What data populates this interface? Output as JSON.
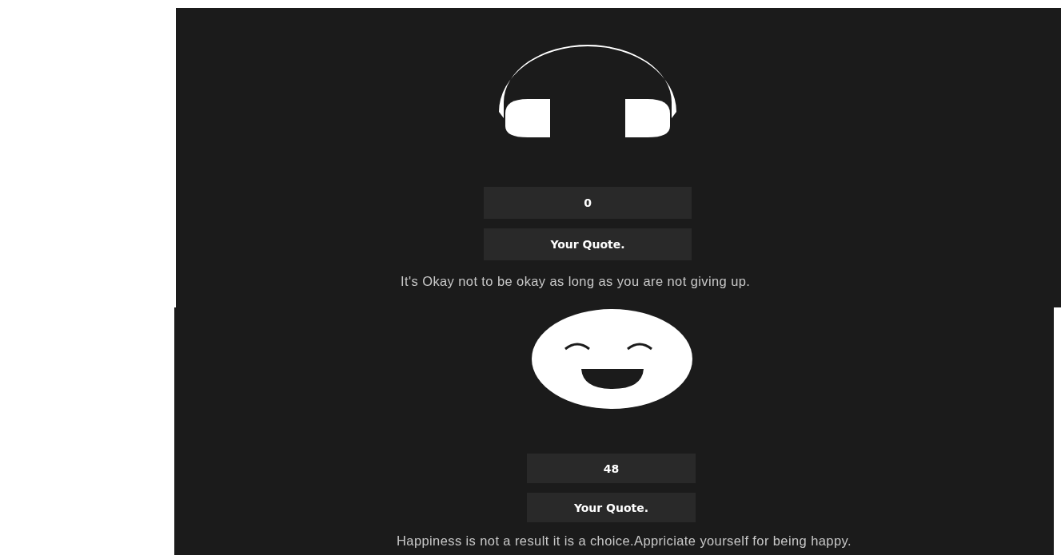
{
  "panels": [
    {
      "kind": "headphones",
      "count": "0",
      "button": "Your Quote.",
      "quote": "It's Okay not to be okay as long as you are not giving up."
    },
    {
      "kind": "smiley",
      "count": "48",
      "button": "Your Quote.",
      "quote": "Happiness is not a result it is a choice.Appriciate yourself for being happy."
    }
  ]
}
